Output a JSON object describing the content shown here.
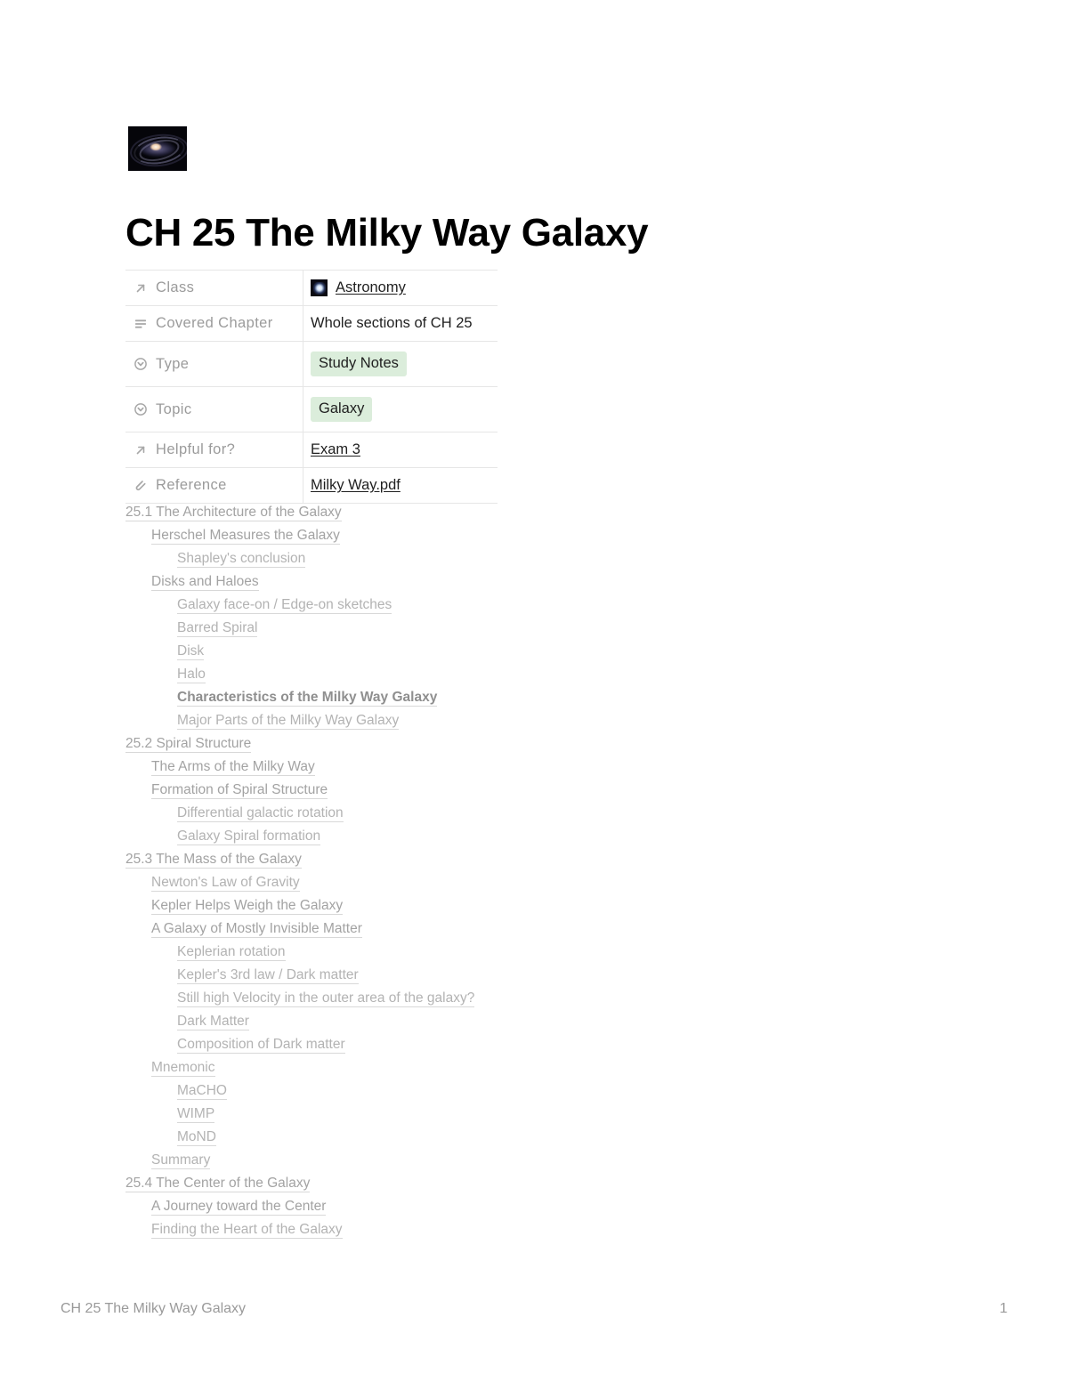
{
  "document": {
    "title": "CH 25 The Milky Way Galaxy",
    "cover_icon": "spiral-galaxy-image"
  },
  "properties": {
    "rows": [
      {
        "icon": "arrow-up-right-icon",
        "label": "Class",
        "value": "Astronomy",
        "value_type": "relation-link",
        "thumb": "galaxy-thumbnail"
      },
      {
        "icon": "text-lines-icon",
        "label": "Covered Chapter",
        "value": "Whole sections of CH 25",
        "value_type": "text"
      },
      {
        "icon": "circled-chevron-down-icon",
        "label": "Type",
        "value": "Study Notes",
        "value_type": "tag",
        "tag_color": "#dbeddb"
      },
      {
        "icon": "circled-chevron-down-icon",
        "label": "Topic",
        "value": "Galaxy",
        "value_type": "tag",
        "tag_color": "#dbeddb"
      },
      {
        "icon": "arrow-up-right-icon",
        "label": "Helpful for?",
        "value": "Exam 3",
        "value_type": "relation-link"
      },
      {
        "icon": "paperclip-icon",
        "label": "Reference",
        "value": "Milky Way.pdf",
        "value_type": "file-link"
      }
    ]
  },
  "table_of_contents": {
    "items": [
      {
        "text": "25.1 The Architecture of the Galaxy",
        "level": 0,
        "emphasis": "mid"
      },
      {
        "text": "Herschel Measures the Galaxy",
        "level": 1,
        "emphasis": "mid"
      },
      {
        "text": "Shapley's conclusion",
        "level": 2,
        "emphasis": "normal"
      },
      {
        "text": "Disks and Haloes",
        "level": 1,
        "emphasis": "mid"
      },
      {
        "text": "Galaxy face-on / Edge-on sketches",
        "level": 2,
        "emphasis": "normal"
      },
      {
        "text": "Barred Spiral",
        "level": 2,
        "emphasis": "normal"
      },
      {
        "text": "Disk",
        "level": 2,
        "emphasis": "normal"
      },
      {
        "text": "Halo",
        "level": 2,
        "emphasis": "normal"
      },
      {
        "text": "Characteristics of the Milky Way Galaxy",
        "level": 2,
        "emphasis": "strong"
      },
      {
        "text": "Major Parts of the Milky Way Galaxy",
        "level": 2,
        "emphasis": "normal"
      },
      {
        "text": "25.2 Spiral Structure",
        "level": 0,
        "emphasis": "mid"
      },
      {
        "text": "The Arms of the Milky Way",
        "level": 1,
        "emphasis": "mid"
      },
      {
        "text": "Formation of Spiral Structure",
        "level": 1,
        "emphasis": "mid"
      },
      {
        "text": "Differential galactic rotation",
        "level": 2,
        "emphasis": "normal"
      },
      {
        "text": "Galaxy Spiral formation",
        "level": 2,
        "emphasis": "normal"
      },
      {
        "text": "25.3 The Mass of the Galaxy",
        "level": 0,
        "emphasis": "mid"
      },
      {
        "text": "Newton's Law of Gravity",
        "level": 1,
        "emphasis": "normal"
      },
      {
        "text": "Kepler Helps Weigh the Galaxy",
        "level": 1,
        "emphasis": "mid"
      },
      {
        "text": "A Galaxy of Mostly Invisible Matter",
        "level": 1,
        "emphasis": "mid"
      },
      {
        "text": "Keplerian rotation",
        "level": 2,
        "emphasis": "normal"
      },
      {
        "text": "Kepler's 3rd law / Dark matter",
        "level": 2,
        "emphasis": "normal"
      },
      {
        "text": "Still high Velocity in the outer area of the galaxy?",
        "level": 2,
        "emphasis": "normal"
      },
      {
        "text": "Dark Matter",
        "level": 2,
        "emphasis": "normal"
      },
      {
        "text": "Composition of Dark matter",
        "level": 2,
        "emphasis": "normal"
      },
      {
        "text": "Mnemonic",
        "level": 1,
        "emphasis": "normal"
      },
      {
        "text": "MaCHO",
        "level": 2,
        "emphasis": "normal"
      },
      {
        "text": "WIMP",
        "level": 2,
        "emphasis": "normal"
      },
      {
        "text": "MoND",
        "level": 2,
        "emphasis": "normal"
      },
      {
        "text": "Summary",
        "level": 1,
        "emphasis": "normal"
      },
      {
        "text": "25.4 The Center of the Galaxy",
        "level": 0,
        "emphasis": "mid"
      },
      {
        "text": "A Journey toward the Center",
        "level": 1,
        "emphasis": "mid"
      },
      {
        "text": "Finding the Heart of the Galaxy",
        "level": 1,
        "emphasis": "normal"
      }
    ]
  },
  "footer": {
    "left": "CH 25 The Milky Way Galaxy",
    "page_number": "1"
  }
}
